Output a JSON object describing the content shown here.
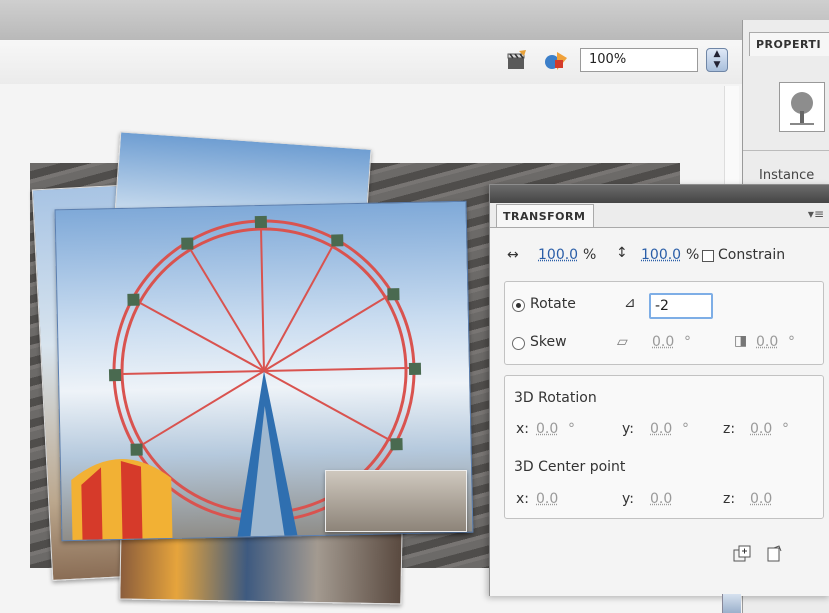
{
  "toolbar": {
    "zoom_value": "100%",
    "icons": [
      "edit-symbols-icon",
      "edit-scene-icon"
    ]
  },
  "properties_panel": {
    "tab_label": "PROPERTI",
    "clipped_text": "Instance"
  },
  "transform_panel": {
    "tab_label": "TRANSFORM",
    "width_value": "100.0",
    "height_value": "100.0",
    "percent_symbol": "%",
    "constrain_label": "Constrain",
    "rotate_label": "Rotate",
    "rotate_value": "-2",
    "skew_label": "Skew",
    "skew_h_value": "0.0",
    "skew_v_value": "0.0",
    "degree_symbol": "°",
    "rotation3d_title": "3D Rotation",
    "rotation3d": {
      "x_label": "x:",
      "x": "0.0",
      "y_label": "y:",
      "y": "0.0",
      "z_label": "z:",
      "z": "0.0"
    },
    "center_title": "3D Center point",
    "center": {
      "x_label": "x:",
      "x": "0.0",
      "y_label": "y:",
      "y": "0.0",
      "z_label": "z:",
      "z": "0.0"
    }
  },
  "colors": {
    "accent": "#2a5ea8",
    "focus_ring": "#7eaee6",
    "panel_bg": "#ececec"
  }
}
